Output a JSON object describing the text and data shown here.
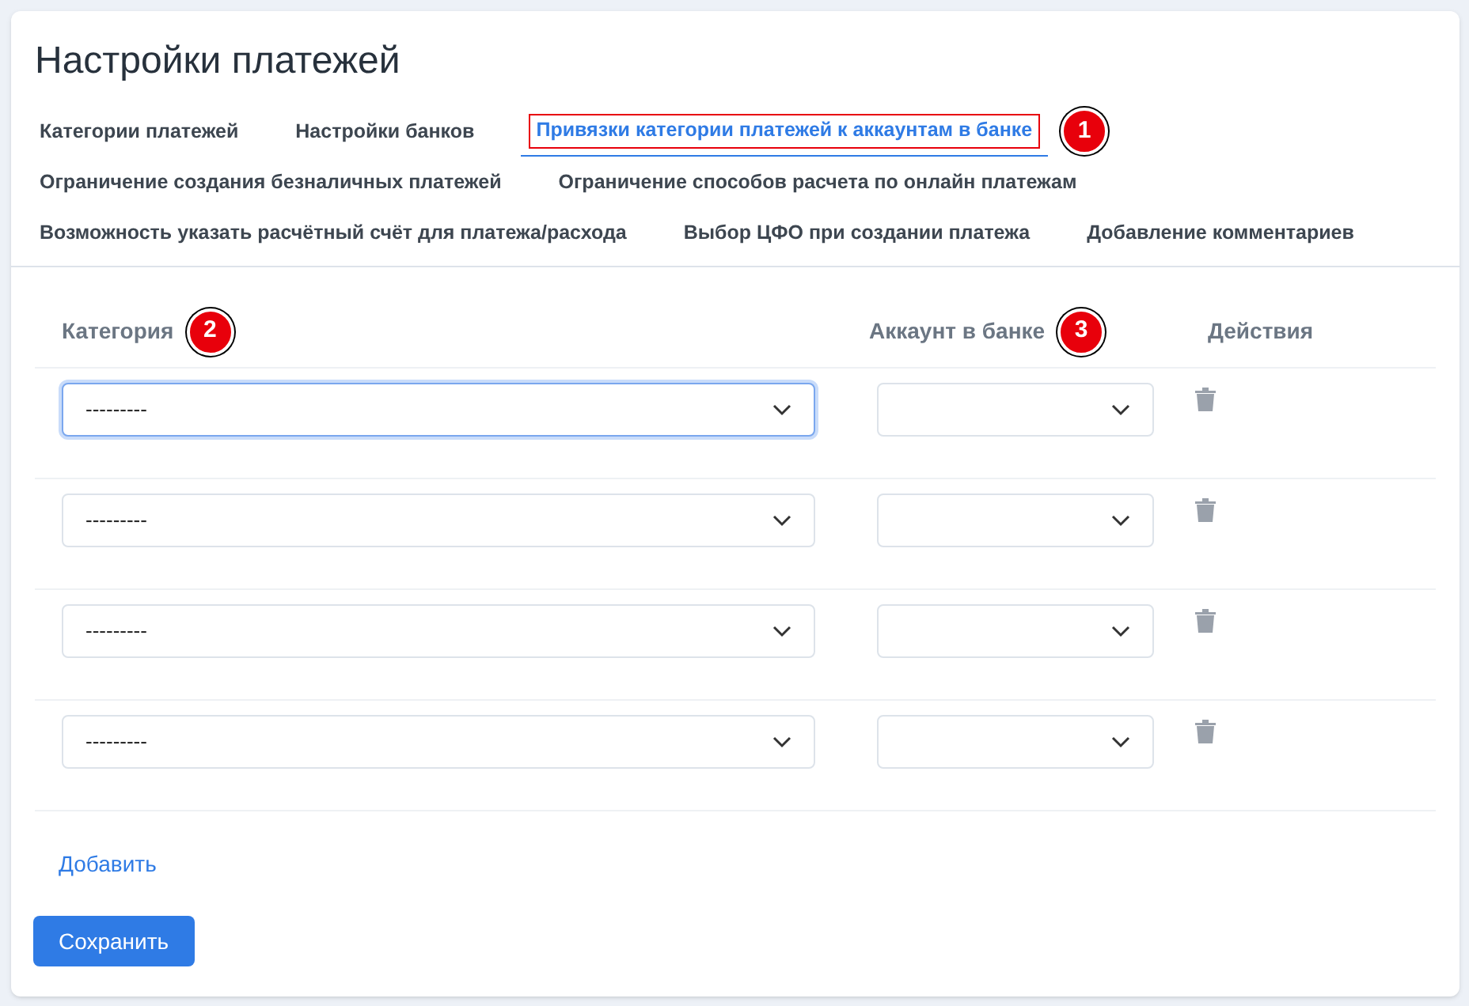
{
  "title": "Настройки платежей",
  "tab_rows": [
    [
      {
        "label": "Категории платежей",
        "selected": false
      },
      {
        "label": "Настройки банков",
        "selected": false
      },
      {
        "label": "Привязки категории платежей к аккаунтам в банке",
        "selected": true,
        "callout": "1"
      }
    ],
    [
      {
        "label": "Ограничение создания безналичных платежей",
        "selected": false
      },
      {
        "label": "Ограничение способов расчета по онлайн платежам",
        "selected": false
      }
    ],
    [
      {
        "label": "Возможность указать расчётный счёт для платежа/расхода",
        "selected": false
      },
      {
        "label": "Выбор ЦФО при создании платежа",
        "selected": false
      },
      {
        "label": "Добавление комментариев",
        "selected": false
      }
    ]
  ],
  "table": {
    "columns": [
      {
        "label": "Категория",
        "callout": "2"
      },
      {
        "label": "Аккаунт в банке",
        "callout": "3"
      },
      {
        "label": "Действия"
      }
    ],
    "rows": [
      {
        "category": "---------",
        "focused": true
      },
      {
        "category": "---------",
        "focused": false
      },
      {
        "category": "---------",
        "focused": false
      },
      {
        "category": "---------",
        "focused": false
      }
    ]
  },
  "add_link": "Добавить",
  "save_button": "Сохранить"
}
